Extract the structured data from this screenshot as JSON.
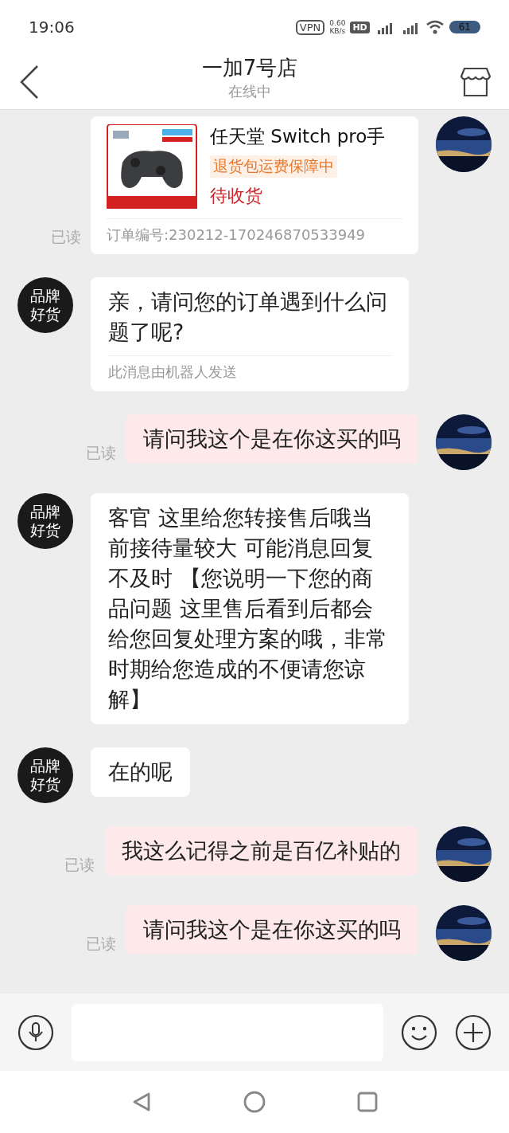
{
  "status_bar": {
    "time": "19:06",
    "vpn": "VPN",
    "speed": "0.60",
    "speed_unit": "KB/s",
    "hd": "HD",
    "battery": "61"
  },
  "header": {
    "title": "一加7号店",
    "subtitle": "在线中"
  },
  "messages": [
    {
      "kind": "order",
      "outgoing": true,
      "title": "任天堂 Switch pro手",
      "tag": "退货包运费保障中",
      "state": "待收货",
      "order_no": "订单编号:230212-170246870533949",
      "status": "已读"
    },
    {
      "kind": "bot",
      "outgoing": false,
      "avatar": "品牌好货",
      "text": "亲，请问您的订单遇到什么问题了呢?",
      "footer": "此消息由机器人发送"
    },
    {
      "kind": "text",
      "outgoing": true,
      "text": "请问我这个是在你这买的吗",
      "status": "已读"
    },
    {
      "kind": "text",
      "outgoing": false,
      "avatar": "品牌好货",
      "text": "客官 这里给您转接售后哦当前接待量较大 可能消息回复不及时 【您说明一下您的商品问题 这里售后看到后都会给您回复处理方案的哦，非常时期给您造成的不便请您谅解】"
    },
    {
      "kind": "text",
      "outgoing": false,
      "avatar": "品牌好货",
      "text": "在的呢"
    },
    {
      "kind": "text",
      "outgoing": true,
      "text": "我这么记得之前是百亿补贴的",
      "status": "已读"
    },
    {
      "kind": "text",
      "outgoing": true,
      "text": "请问我这个是在你这买的吗",
      "status": "已读"
    }
  ]
}
